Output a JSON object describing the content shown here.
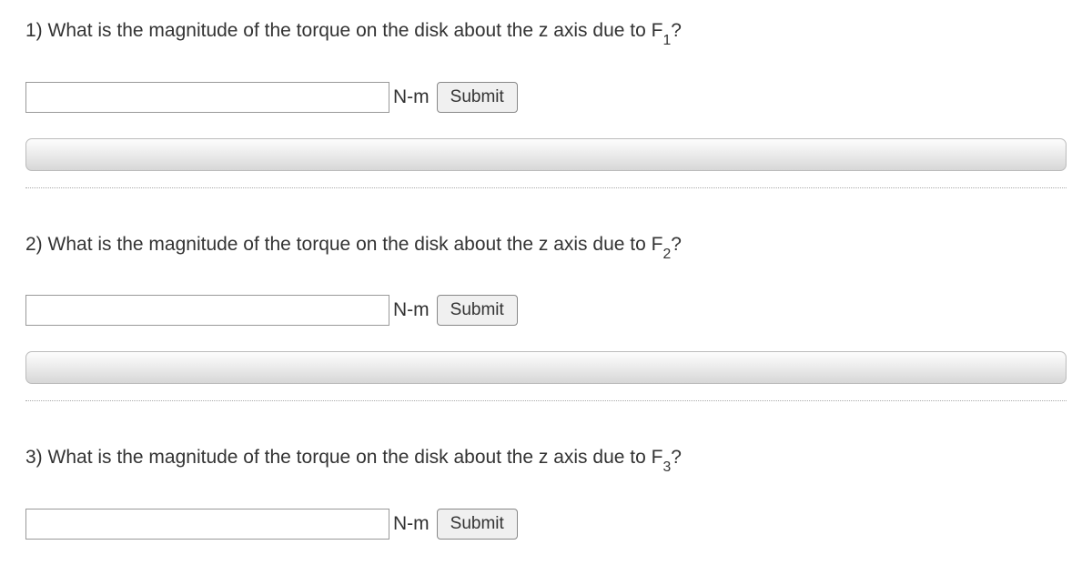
{
  "questions": [
    {
      "number": "1)",
      "prompt_before": "What is the magnitude of the torque on the disk about the z axis due to F",
      "subscript": "1",
      "prompt_after": "?",
      "unit": "N-m",
      "submit_label": "Submit"
    },
    {
      "number": "2)",
      "prompt_before": "What is the magnitude of the torque on the disk about the z axis due to F",
      "subscript": "2",
      "prompt_after": "?",
      "unit": "N-m",
      "submit_label": "Submit"
    },
    {
      "number": "3)",
      "prompt_before": "What is the magnitude of the torque on the disk about the z axis due to F",
      "subscript": "3",
      "prompt_after": "?",
      "unit": "N-m",
      "submit_label": "Submit"
    }
  ]
}
